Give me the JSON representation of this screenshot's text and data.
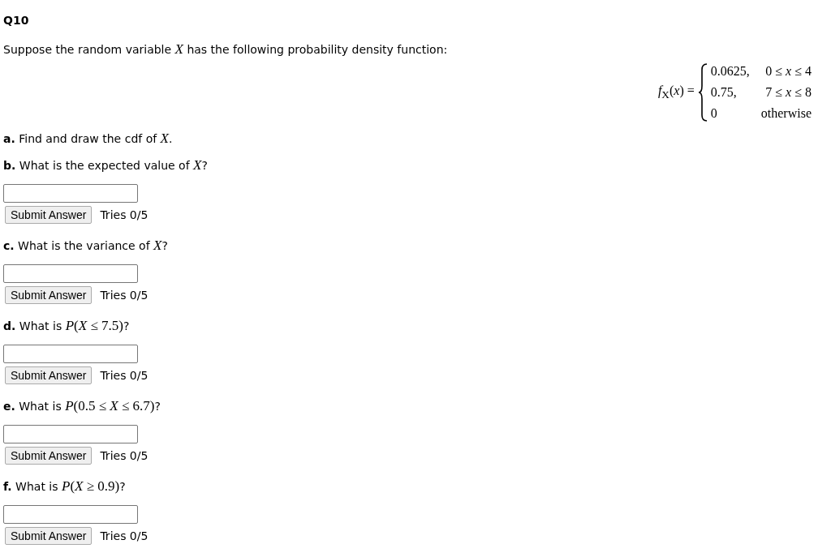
{
  "title": "Q10",
  "intro": {
    "text": "Suppose the random variable",
    "math": "*X*",
    "tail": "has the following probability density function:"
  },
  "formula": {
    "lhs": "*f*$_{X}$(*x*) =",
    "rows": [
      {
        "value": "0.0625,",
        "condition": "0 ≤ *x* ≤ 4"
      },
      {
        "value": "0.75,",
        "condition": "7 ≤ *x* ≤ 8"
      },
      {
        "value": "0",
        "condition": "otherwise"
      }
    ]
  },
  "questions": [
    {
      "kind": "info",
      "label": "a.",
      "text": "Find and draw the cdf of",
      "math": "*X*",
      "tail": "."
    },
    {
      "kind": "answer",
      "label": "b.",
      "text": "What is the expected value of",
      "math": "*X*",
      "tail": "?",
      "button": "Submit Answer",
      "tries": "Tries 0/5"
    },
    {
      "kind": "answer",
      "label": "c.",
      "text": "What is the variance of",
      "math": "*X*",
      "tail": "?",
      "button": "Submit Answer",
      "tries": "Tries 0/5"
    },
    {
      "kind": "answer",
      "label": "d.",
      "text": "What is",
      "math": "*P*(*X* ≤ 7.5)",
      "tail": "?",
      "button": "Submit Answer",
      "tries": "Tries 0/5"
    },
    {
      "kind": "answer",
      "label": "e.",
      "text": "What is",
      "math": "*P*(0.5 ≤ *X* ≤ 6.7)",
      "tail": "?",
      "button": "Submit Answer",
      "tries": "Tries 0/5"
    },
    {
      "kind": "answer",
      "label": "f.",
      "text": "What is",
      "math": "*P*(*X* ≥ 0.9)",
      "tail": "?",
      "button": "Submit Answer",
      "tries": "Tries 0/5"
    }
  ]
}
